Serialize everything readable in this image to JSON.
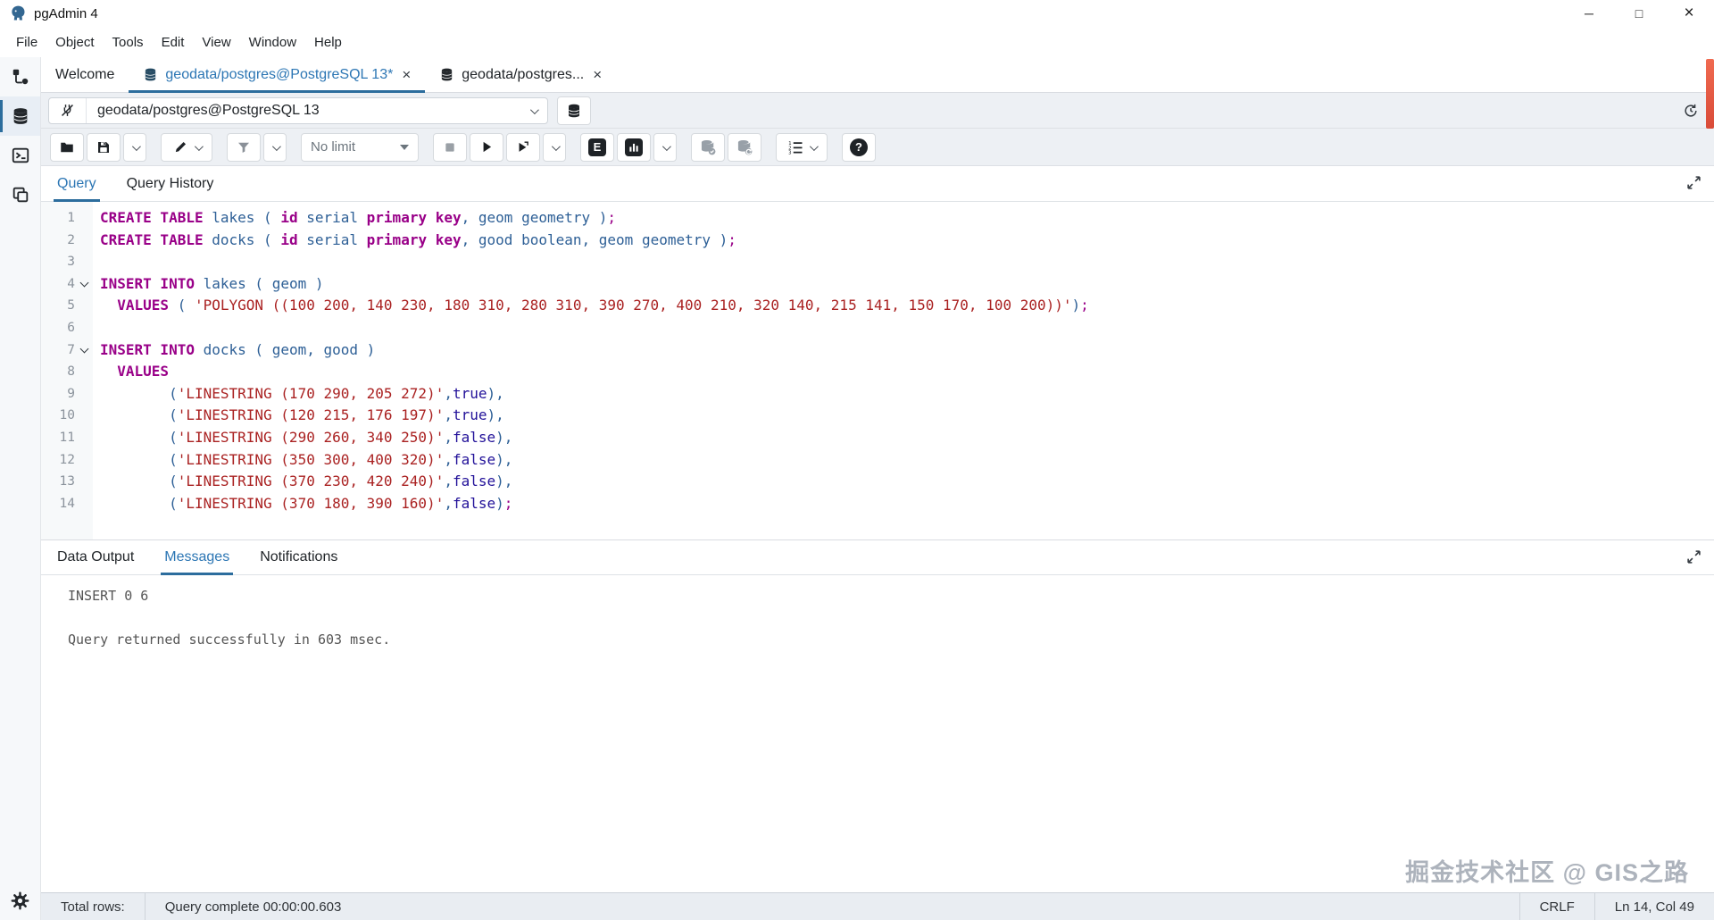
{
  "window": {
    "title": "pgAdmin 4",
    "controls": {
      "minimize": "─",
      "maximize": "□",
      "close": "×"
    }
  },
  "menu": {
    "items": [
      "File",
      "Object",
      "Tools",
      "Edit",
      "View",
      "Window",
      "Help"
    ]
  },
  "tabs": {
    "welcome": "Welcome",
    "query_tab": "geodata/postgres@PostgreSQL 13*",
    "other_tab": "geodata/postgres...",
    "close_glyph": "×"
  },
  "connection": {
    "value": "geodata/postgres@PostgreSQL 13"
  },
  "toolbar": {
    "limit_label": "No limit",
    "explain_label": "E",
    "help_label": "?"
  },
  "editor_tabs": {
    "query": "Query",
    "history": "Query History"
  },
  "editor": {
    "lines": [
      {
        "n": 1,
        "fold": false,
        "t": [
          [
            "kw",
            "CREATE TABLE"
          ],
          [
            "txt",
            " "
          ],
          [
            "id",
            "lakes"
          ],
          [
            "pun",
            " ( "
          ],
          [
            "kw",
            "id"
          ],
          [
            "txt",
            " "
          ],
          [
            "id",
            "serial"
          ],
          [
            "txt",
            " "
          ],
          [
            "kw",
            "primary key"
          ],
          [
            "pun",
            ", "
          ],
          [
            "id",
            "geom"
          ],
          [
            "txt",
            " "
          ],
          [
            "id",
            "geometry"
          ],
          [
            "pun",
            " )"
          ],
          [
            "semi",
            ";"
          ]
        ]
      },
      {
        "n": 2,
        "fold": false,
        "t": [
          [
            "kw",
            "CREATE TABLE"
          ],
          [
            "txt",
            " "
          ],
          [
            "id",
            "docks"
          ],
          [
            "pun",
            " ( "
          ],
          [
            "kw",
            "id"
          ],
          [
            "txt",
            " "
          ],
          [
            "id",
            "serial"
          ],
          [
            "txt",
            " "
          ],
          [
            "kw",
            "primary key"
          ],
          [
            "pun",
            ", "
          ],
          [
            "id",
            "good"
          ],
          [
            "txt",
            " "
          ],
          [
            "id",
            "boolean"
          ],
          [
            "pun",
            ", "
          ],
          [
            "id",
            "geom"
          ],
          [
            "txt",
            " "
          ],
          [
            "id",
            "geometry"
          ],
          [
            "pun",
            " )"
          ],
          [
            "semi",
            ";"
          ]
        ]
      },
      {
        "n": 3,
        "fold": false,
        "t": []
      },
      {
        "n": 4,
        "fold": true,
        "t": [
          [
            "kw",
            "INSERT INTO"
          ],
          [
            "txt",
            " "
          ],
          [
            "id",
            "lakes"
          ],
          [
            "pun",
            " ( "
          ],
          [
            "id",
            "geom"
          ],
          [
            "pun",
            " )"
          ]
        ]
      },
      {
        "n": 5,
        "fold": false,
        "t": [
          [
            "txt",
            "  "
          ],
          [
            "kw",
            "VALUES"
          ],
          [
            "pun",
            " ( "
          ],
          [
            "str",
            "'POLYGON ((100 200, 140 230, 180 310, 280 310, 390 270, 400 210, 320 140, 215 141, 150 170, 100 200))'"
          ],
          [
            "pun",
            ")"
          ],
          [
            "semi",
            ";"
          ]
        ]
      },
      {
        "n": 6,
        "fold": false,
        "t": []
      },
      {
        "n": 7,
        "fold": true,
        "t": [
          [
            "kw",
            "INSERT INTO"
          ],
          [
            "txt",
            " "
          ],
          [
            "id",
            "docks"
          ],
          [
            "pun",
            " ( "
          ],
          [
            "id",
            "geom"
          ],
          [
            "pun",
            ", "
          ],
          [
            "id",
            "good"
          ],
          [
            "pun",
            " )"
          ]
        ]
      },
      {
        "n": 8,
        "fold": false,
        "t": [
          [
            "txt",
            "  "
          ],
          [
            "kw",
            "VALUES"
          ]
        ]
      },
      {
        "n": 9,
        "fold": false,
        "t": [
          [
            "txt",
            "        "
          ],
          [
            "pun",
            "("
          ],
          [
            "str",
            "'LINESTRING (170 290, 205 272)'"
          ],
          [
            "pun",
            ","
          ],
          [
            "atom",
            "true"
          ],
          [
            "pun",
            "),"
          ]
        ]
      },
      {
        "n": 10,
        "fold": false,
        "t": [
          [
            "txt",
            "        "
          ],
          [
            "pun",
            "("
          ],
          [
            "str",
            "'LINESTRING (120 215, 176 197)'"
          ],
          [
            "pun",
            ","
          ],
          [
            "atom",
            "true"
          ],
          [
            "pun",
            "),"
          ]
        ]
      },
      {
        "n": 11,
        "fold": false,
        "t": [
          [
            "txt",
            "        "
          ],
          [
            "pun",
            "("
          ],
          [
            "str",
            "'LINESTRING (290 260, 340 250)'"
          ],
          [
            "pun",
            ","
          ],
          [
            "atom",
            "false"
          ],
          [
            "pun",
            "),"
          ]
        ]
      },
      {
        "n": 12,
        "fold": false,
        "t": [
          [
            "txt",
            "        "
          ],
          [
            "pun",
            "("
          ],
          [
            "str",
            "'LINESTRING (350 300, 400 320)'"
          ],
          [
            "pun",
            ","
          ],
          [
            "atom",
            "false"
          ],
          [
            "pun",
            "),"
          ]
        ]
      },
      {
        "n": 13,
        "fold": false,
        "t": [
          [
            "txt",
            "        "
          ],
          [
            "pun",
            "("
          ],
          [
            "str",
            "'LINESTRING (370 230, 420 240)'"
          ],
          [
            "pun",
            ","
          ],
          [
            "atom",
            "false"
          ],
          [
            "pun",
            "),"
          ]
        ]
      },
      {
        "n": 14,
        "fold": false,
        "t": [
          [
            "txt",
            "        "
          ],
          [
            "pun",
            "("
          ],
          [
            "str",
            "'LINESTRING (370 180, 390 160)'"
          ],
          [
            "pun",
            ","
          ],
          [
            "atom",
            "false"
          ],
          [
            "pun",
            ")"
          ],
          [
            "semi",
            ";"
          ]
        ]
      }
    ]
  },
  "output": {
    "tabs": [
      "Data Output",
      "Messages",
      "Notifications"
    ],
    "active": "Messages",
    "messages": {
      "insert": "INSERT 0 6",
      "result": "Query returned successfully in 603 msec."
    }
  },
  "status_bar": {
    "total_rows": "Total rows:",
    "query_complete": "Query complete 00:00:00.603",
    "line_ending": "CRLF",
    "cursor": "Ln 14, Col 49"
  },
  "watermark": "掘金技术社区 @ GIS之路",
  "colors": {
    "accent": "#2c6d9d",
    "active_tab_text": "#2c76b4",
    "keyword": "#990088",
    "identifier": "#2d5f96",
    "string": "#aa2222",
    "atom": "#221199",
    "toolbar_bg": "#edf0f4",
    "status_bg": "#e9edf2",
    "scroll_strip": "#e2574c"
  }
}
